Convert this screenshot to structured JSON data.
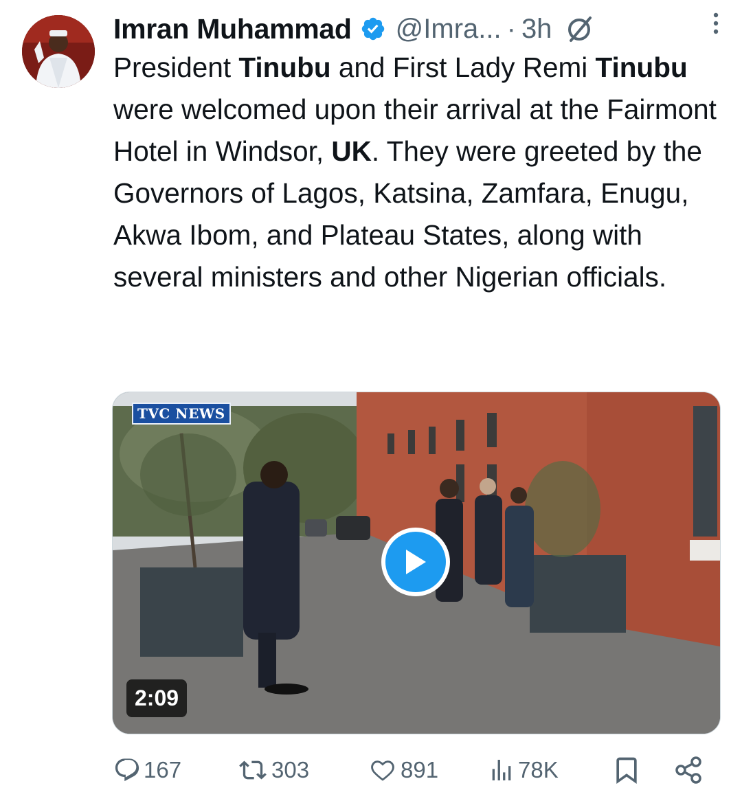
{
  "tweet": {
    "author_name": "Imran Muhammad",
    "handle": "@Imra...",
    "separator": "·",
    "time": "3h",
    "text_segments": [
      {
        "t": "President ",
        "b": false
      },
      {
        "t": "Tinubu",
        "b": true
      },
      {
        "t": " and First Lady Remi ",
        "b": false
      },
      {
        "t": "Tinubu",
        "b": true
      },
      {
        "t": " were welcomed upon their arrival at the Fairmont Hotel in Windsor, ",
        "b": false
      },
      {
        "t": "UK",
        "b": true
      },
      {
        "t": ". They were greeted by the Governors of Lagos, Katsina, Zamfara, Enugu, Akwa Ibom, and Plateau States, along with several ministers and other Nigerian officials.",
        "b": false
      }
    ]
  },
  "media": {
    "logo_text": "TVC NEWS",
    "duration": "2:09"
  },
  "actions": {
    "replies": "167",
    "reposts": "303",
    "likes": "891",
    "views": "78K"
  },
  "colors": {
    "accent": "#1d9bf0",
    "text": "#0f1419",
    "muted": "#536471"
  },
  "icons": [
    "verified-badge-icon",
    "grok-icon",
    "more-icon",
    "play-icon",
    "reply-icon",
    "repost-icon",
    "like-icon",
    "views-icon",
    "bookmark-icon",
    "share-icon"
  ]
}
